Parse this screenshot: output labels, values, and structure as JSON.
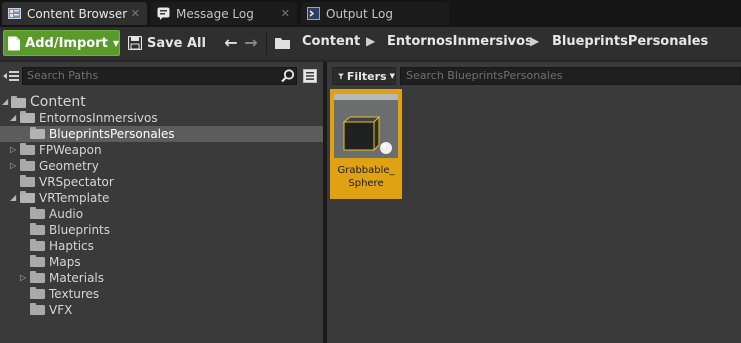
{
  "tabs": [
    {
      "label": "Content Browser",
      "icon": "content-browser-icon"
    },
    {
      "label": "Message Log",
      "icon": "message-log-icon"
    },
    {
      "label": "Output Log",
      "icon": "output-log-icon"
    }
  ],
  "toolbar": {
    "add_import_label": "Add/Import",
    "save_all_label": "Save All"
  },
  "breadcrumb": [
    "Content",
    "EntornosInmersivos",
    "BlueprintsPersonales"
  ],
  "sources": {
    "search_placeholder": "Search Paths",
    "tree": [
      {
        "label": "Content"
      },
      {
        "label": "EntornosInmersivos"
      },
      {
        "label": "BlueprintsPersonales"
      },
      {
        "label": "FPWeapon"
      },
      {
        "label": "Geometry"
      },
      {
        "label": "VRSpectator"
      },
      {
        "label": "VRTemplate"
      },
      {
        "label": "Audio"
      },
      {
        "label": "Blueprints"
      },
      {
        "label": "Haptics"
      },
      {
        "label": "Maps"
      },
      {
        "label": "Materials"
      },
      {
        "label": "Textures"
      },
      {
        "label": "VFX"
      }
    ]
  },
  "assets": {
    "filters_label": "Filters",
    "search_placeholder": "Search BlueprintsPersonales",
    "items": [
      {
        "name_line1": "Grabbable_",
        "name_line2": "Sphere"
      }
    ]
  },
  "colors": {
    "accent_green": "#5a9a2a",
    "selection_orange": "#e0a112",
    "panel_bg": "#3a3a3a"
  }
}
